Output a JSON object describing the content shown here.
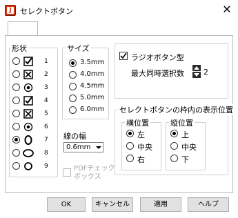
{
  "window": {
    "title": "セレクトボタン",
    "app_icon_letter": "J",
    "close_glyph": "✕"
  },
  "shape_group": {
    "label": "形状",
    "items": [
      {
        "num": "1",
        "shape": "checkbox-check",
        "selected": false
      },
      {
        "num": "2",
        "shape": "checkbox-cross",
        "selected": false
      },
      {
        "num": "3",
        "shape": "radio-dot",
        "selected": false
      },
      {
        "num": "4",
        "shape": "checkbox-check",
        "selected": false
      },
      {
        "num": "5",
        "shape": "checkbox-cross",
        "selected": false
      },
      {
        "num": "6",
        "shape": "radio-dot",
        "selected": false
      },
      {
        "num": "7",
        "shape": "oval-tall",
        "selected": true
      },
      {
        "num": "8",
        "shape": "oval-wide",
        "selected": false
      },
      {
        "num": "9",
        "shape": "circle-small",
        "selected": false
      }
    ]
  },
  "size_group": {
    "label": "サイズ",
    "options": [
      {
        "label": "3.5mm",
        "selected": true
      },
      {
        "label": "4.0mm",
        "selected": false
      },
      {
        "label": "4.5mm",
        "selected": false
      },
      {
        "label": "5.0mm",
        "selected": false
      },
      {
        "label": "6.0mm",
        "selected": false
      }
    ]
  },
  "line_width": {
    "label": "線の幅",
    "value": "0.6mm"
  },
  "pdf_check": {
    "label_line1": "PDFチェック",
    "label_line2": "ボックス",
    "checked": false,
    "disabled": true
  },
  "radio_type": {
    "checkbox_label": "ラジオボタン型",
    "checked": true,
    "max_label": "最大同時選択数",
    "max_value": "2"
  },
  "position_group": {
    "label": "セレクトボタンの枠内の表示位置",
    "horizontal": {
      "label": "横位置",
      "options": [
        {
          "label": "左",
          "selected": true
        },
        {
          "label": "中央",
          "selected": false
        },
        {
          "label": "右",
          "selected": false
        }
      ]
    },
    "vertical": {
      "label": "縦位置",
      "options": [
        {
          "label": "上",
          "selected": true
        },
        {
          "label": "中央",
          "selected": false
        },
        {
          "label": "下",
          "selected": false
        }
      ]
    }
  },
  "buttons": {
    "ok": "OK",
    "cancel": "キャンセル",
    "apply": "適用",
    "help": "ヘルプ"
  }
}
